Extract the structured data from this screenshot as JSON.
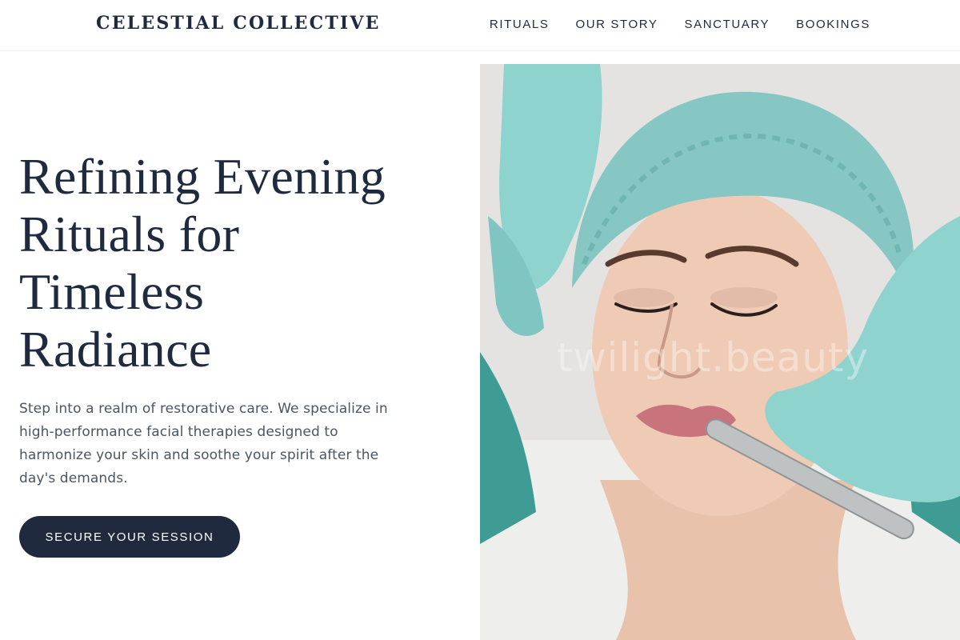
{
  "brand": {
    "name": "CELESTIAL COLLECTIVE"
  },
  "nav": {
    "items": [
      {
        "label": "RITUALS"
      },
      {
        "label": "OUR STORY"
      },
      {
        "label": "SANCTUARY"
      },
      {
        "label": "BOOKINGS"
      }
    ]
  },
  "hero": {
    "headline_lines": [
      "Refining Evening",
      "Rituals for",
      "Timeless",
      "Radiance"
    ],
    "subtext": "Step into a realm of restorative care. We specialize in high-performance facial therapies designed to harmonize your skin and soothe your spirit after the day's demands.",
    "cta_label": "SECURE YOUR SESSION",
    "image_watermark": "twilight.beauty"
  },
  "colors": {
    "navy": "#1f2a3f",
    "body_text": "#4b5563",
    "glove": "#8fd3cf",
    "cap": "#88c8c4"
  }
}
